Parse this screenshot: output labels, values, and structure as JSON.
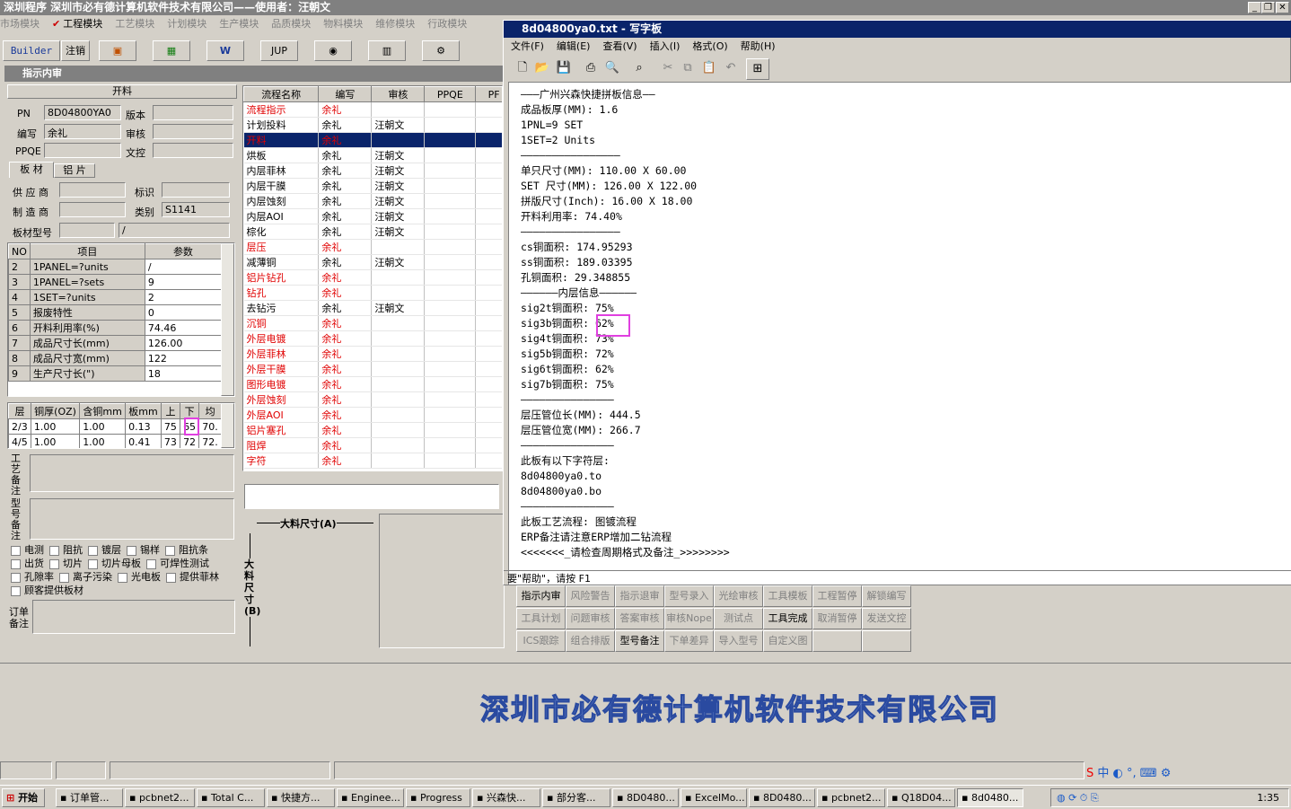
{
  "app": {
    "title": "深圳程序    深圳市必有德计算机软件技术有限公司——使用者：汪朝文"
  },
  "modules": [
    "市场模块",
    "工程模块",
    "工艺模块",
    "计划模块",
    "生产模块",
    "品质模块",
    "物料模块",
    "维修模块",
    "行政模块"
  ],
  "toolbar": {
    "builder": "Builder",
    "logout": "注销",
    "jup": "JUP"
  },
  "panel": {
    "title": "指示内审",
    "section": "开料"
  },
  "form": {
    "pn_label": "PN",
    "pn": "8D04800YA0",
    "version_label": "版本",
    "writer_label": "编写",
    "writer": "余礼",
    "review_label": "审核",
    "ppqe_label": "PPQE",
    "control_label": "文控"
  },
  "tabs": [
    "板 材",
    "铝 片"
  ],
  "material": {
    "supplier": "供 应 商",
    "mark": "标识",
    "maker": "制 造 商",
    "category": "类别",
    "category_val": "S1141",
    "model": "板材型号",
    "model_val": "/"
  },
  "params": {
    "headers": [
      "NO",
      "项目",
      "参数"
    ],
    "rows": [
      [
        "2",
        "1PANEL=?units",
        "/"
      ],
      [
        "3",
        "1PANEL=?sets",
        "9"
      ],
      [
        "4",
        "1SET=?units",
        "2"
      ],
      [
        "5",
        "报废特性",
        "0"
      ],
      [
        "6",
        "开料利用率(%)",
        "74.46"
      ],
      [
        "7",
        "成品尺寸长(mm)",
        "126.00"
      ],
      [
        "8",
        "成品尺寸宽(mm)",
        "122"
      ],
      [
        "9",
        "生产尺寸长(\")",
        "18"
      ]
    ]
  },
  "layers": {
    "headers": [
      "层",
      "铜厚(OZ)",
      "含铜mm",
      "板mm",
      "上",
      "下",
      "均"
    ],
    "rows": [
      [
        "2/3",
        "1.00",
        "1.00",
        "0.13",
        "75",
        "65",
        "70."
      ],
      [
        "4/5",
        "1.00",
        "1.00",
        "0.41",
        "73",
        "72",
        "72."
      ]
    ]
  },
  "notes": {
    "craft": "工艺备注",
    "model": "型号备注",
    "order": "订单备注"
  },
  "checkboxes": [
    "电测",
    "阻抗",
    "镀层",
    "锡样",
    "阻抗条",
    "出货",
    "切片",
    "切片母板",
    "可焊性测试",
    "孔隙率",
    "离子污染",
    "光电板",
    "提供菲林",
    "顾客提供板材"
  ],
  "process": {
    "headers": [
      "流程名称",
      "编写",
      "审核",
      "PPQE",
      "PF"
    ],
    "rows": [
      {
        "name": "流程指示",
        "w": "余礼",
        "r": "",
        "red": true
      },
      {
        "name": "计划投料",
        "w": "余礼",
        "r": "汪朝文",
        "red": false
      },
      {
        "name": "开料",
        "w": "余礼",
        "r": "",
        "red": true,
        "sel": true
      },
      {
        "name": "烘板",
        "w": "余礼",
        "r": "汪朝文",
        "red": false
      },
      {
        "name": "内层菲林",
        "w": "余礼",
        "r": "汪朝文",
        "red": false
      },
      {
        "name": "内层干膜",
        "w": "余礼",
        "r": "汪朝文",
        "red": false
      },
      {
        "name": "内层蚀刻",
        "w": "余礼",
        "r": "汪朝文",
        "red": false
      },
      {
        "name": "内层AOI",
        "w": "余礼",
        "r": "汪朝文",
        "red": false
      },
      {
        "name": "棕化",
        "w": "余礼",
        "r": "汪朝文",
        "red": false
      },
      {
        "name": "层压",
        "w": "余礼",
        "r": "",
        "red": true
      },
      {
        "name": "减薄铜",
        "w": "余礼",
        "r": "汪朝文",
        "red": false
      },
      {
        "name": "铝片钻孔",
        "w": "余礼",
        "r": "",
        "red": true
      },
      {
        "name": "钻孔",
        "w": "余礼",
        "r": "",
        "red": true
      },
      {
        "name": "去钻污",
        "w": "余礼",
        "r": "汪朝文",
        "red": false
      },
      {
        "name": "沉铜",
        "w": "余礼",
        "r": "",
        "red": true
      },
      {
        "name": "外层电镀",
        "w": "余礼",
        "r": "",
        "red": true
      },
      {
        "name": "外层菲林",
        "w": "余礼",
        "r": "",
        "red": true
      },
      {
        "name": "外层干膜",
        "w": "余礼",
        "r": "",
        "red": true
      },
      {
        "name": "图形电镀",
        "w": "余礼",
        "r": "",
        "red": true
      },
      {
        "name": "外层蚀刻",
        "w": "余礼",
        "r": "",
        "red": true
      },
      {
        "name": "外层AOI",
        "w": "余礼",
        "r": "",
        "red": true
      },
      {
        "name": "铝片塞孔",
        "w": "余礼",
        "r": "",
        "red": true
      },
      {
        "name": "阻焊",
        "w": "余礼",
        "r": "",
        "red": true
      },
      {
        "name": "字符",
        "w": "余礼",
        "r": "",
        "red": true
      }
    ]
  },
  "dims": {
    "a": "大料尺寸(A)",
    "b": "大料尺寸(B)"
  },
  "wordpad": {
    "title": "8d04800ya0.txt - 写字板",
    "menu": [
      "文件(F)",
      "编辑(E)",
      "查看(V)",
      "插入(I)",
      "格式(O)",
      "帮助(H)"
    ],
    "status": "要\"帮助\"，请按 F1",
    "lines": [
      "———广州兴森快捷拼板信息——",
      "成品板厚(MM): 1.6",
      "1PNL=9 SET",
      "1SET=2 Units",
      "————————————————",
      "单只尺寸(MM): 110.00 X 60.00",
      "SET 尺寸(MM): 126.00 X 122.00",
      "拼版尺寸(Inch): 16.00 X 18.00",
      "开料利用率: 74.40%",
      "————————————————",
      "cs铜面积: 174.95293",
      "ss铜面积: 189.03395",
      "孔铜面积: 29.348855",
      "——————内层信息——————",
      "sig2t铜面积: 75%",
      "sig3b铜面积: 62%",
      "sig4t铜面积: 73%",
      "sig5b铜面积: 72%",
      "sig6t铜面积: 62%",
      "sig7b铜面积: 75%",
      "———————————————",
      "层压管位长(MM): 444.5",
      "层压管位宽(MM): 266.7",
      "———————————————",
      "此板有以下字符层:",
      "8d04800ya0.to",
      "8d04800ya0.bo",
      "———————————————",
      "此板工艺流程: 图镀流程",
      "ERP备注请注意ERP增加二钻流程",
      "<<<<<<<_请检查周期格式及备注_>>>>>>>>"
    ]
  },
  "funcs": [
    [
      "指示内审",
      "风险警告",
      "指示退审",
      "型号录入",
      "光绘审核",
      "工具模板",
      "工程暂停",
      "解锁编写"
    ],
    [
      "工具计划",
      "问题审核",
      "答案审核",
      "审核Nope",
      "测试点",
      "工具完成",
      "取消暂停",
      "发送文控"
    ],
    [
      "ICS跟踪",
      "组合排版",
      "型号备注",
      "下单差异",
      "导入型号",
      "自定义图",
      "",
      ""
    ]
  ],
  "funcs_enabled": [
    "指示内审",
    "工具完成",
    "型号备注"
  ],
  "banner": "深圳市必有德计算机软件技术有限公司",
  "taskbar": {
    "start": "开始",
    "tasks": [
      "订单管...",
      "pcbnet2...",
      "Total C...",
      "快捷方...",
      "Enginee...",
      "Progress",
      "兴森快...",
      "部分客...",
      "8D0480...",
      "ExcelMo...",
      "8D0480...",
      "pcbnet2...",
      "Q18D04...",
      "8d0480..."
    ],
    "clock": "1:35",
    "ime": "中"
  }
}
